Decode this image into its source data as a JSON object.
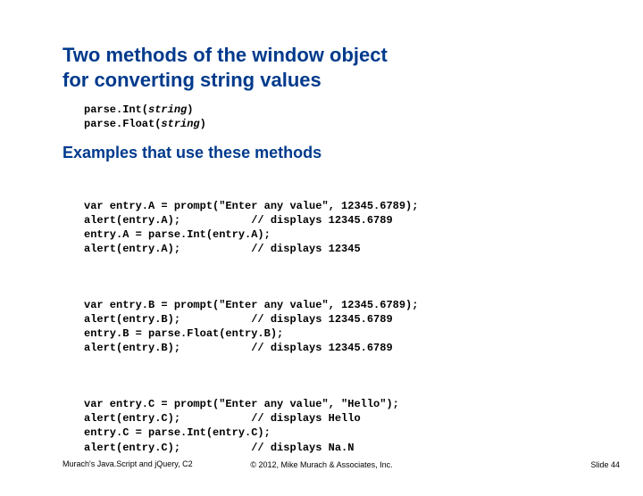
{
  "title_line1": "Two methods of the window object",
  "title_line2": "for converting string values",
  "methods": {
    "m1_name": "parse.Int(",
    "m1_arg": "string",
    "m1_close": ")",
    "m2_name": "parse.Float(",
    "m2_arg": "string",
    "m2_close": ")"
  },
  "subheading": "Examples that use these methods",
  "code": {
    "block1": "var entry.A = prompt(\"Enter any value\", 12345.6789);\nalert(entry.A);           // displays 12345.6789\nentry.A = parse.Int(entry.A);\nalert(entry.A);           // displays 12345",
    "block2": "var entry.B = prompt(\"Enter any value\", 12345.6789);\nalert(entry.B);           // displays 12345.6789\nentry.B = parse.Float(entry.B);\nalert(entry.B);           // displays 12345.6789",
    "block3": "var entry.C = prompt(\"Enter any value\", \"Hello\");\nalert(entry.C);           // displays Hello\nentry.C = parse.Int(entry.C);\nalert(entry.C);           // displays Na.N"
  },
  "footer": {
    "left": "Murach's Java.Script and jQuery, C2",
    "center": "© 2012, Mike Murach & Associates, Inc.",
    "right": "Slide 44"
  }
}
